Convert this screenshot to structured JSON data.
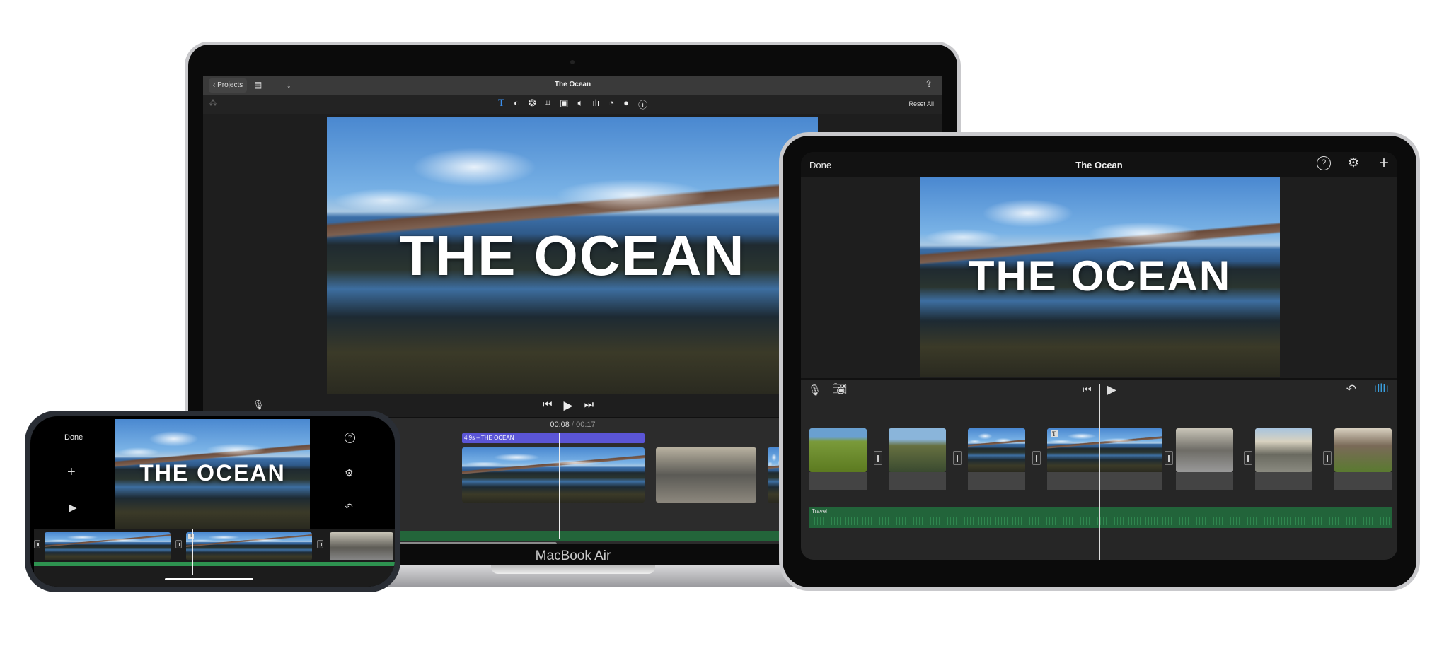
{
  "macbook": {
    "device_label": "MacBook Air",
    "back_button": "Projects",
    "title": "The Ocean",
    "reset_all": "Reset All",
    "preview_title": "THE OCEAN",
    "timecode_current": "00:08",
    "timecode_sep": "/",
    "timecode_total": "00:17",
    "title_clip_label": "4.9s – THE OCEAN",
    "toolbar_icons": [
      "title-icon",
      "color-balance-icon",
      "color-correction-icon",
      "crop-icon",
      "stabilization-icon",
      "volume-icon",
      "noise-reduction-icon",
      "speed-icon",
      "filter-icon",
      "info-icon"
    ],
    "accent": "#3b8eea",
    "title_clip_color": "#5b55d6",
    "audio_color": "#23653a"
  },
  "ipad": {
    "done": "Done",
    "title": "The Ocean",
    "preview_title": "THE OCEAN",
    "audio_track": "Travel",
    "clip_count": 7
  },
  "iphone": {
    "done": "Done",
    "preview_title": "THE OCEAN"
  }
}
